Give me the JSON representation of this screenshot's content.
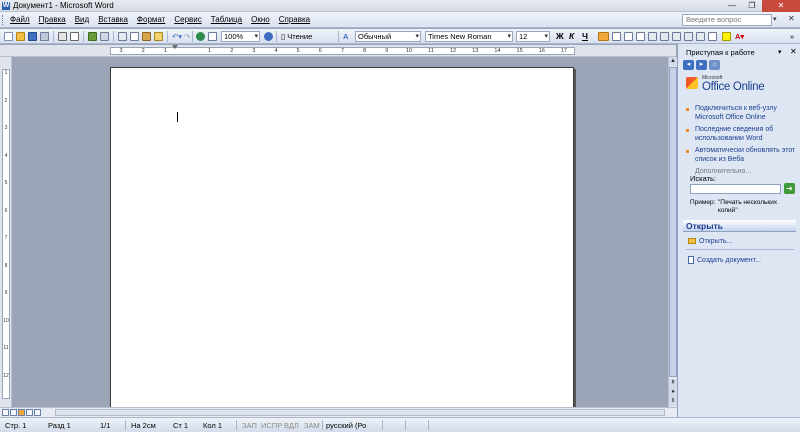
{
  "window": {
    "title": "Документ1 - Microsoft Word"
  },
  "menubar": {
    "items": [
      "Файл",
      "Правка",
      "Вид",
      "Вставка",
      "Формат",
      "Сервис",
      "Таблица",
      "Окно",
      "Справка"
    ],
    "help_placeholder": "Введите вопрос"
  },
  "toolbar": {
    "zoom": "100%",
    "reading_label": "Чтение",
    "style": "Обычный",
    "font": "Times New Roman",
    "font_size": "12",
    "bold": "Ж",
    "italic": "К",
    "underline": "Ч"
  },
  "ruler": {
    "ticks": [
      "3",
      "2",
      "1",
      "",
      "1",
      "2",
      "3",
      "4",
      "5",
      "6",
      "7",
      "8",
      "9",
      "10",
      "11",
      "12",
      "13",
      "14",
      "15",
      "16",
      "17"
    ]
  },
  "taskpane": {
    "title": "Приступая к работе",
    "logo_small": "Microsoft",
    "logo_text": "Office Online",
    "links": [
      "Подключиться к веб-узлу Microsoft Office Online",
      "Последние сведения об использовании Word",
      "Автоматически обновлять этот список из Веба"
    ],
    "more": "Дополнительно...",
    "search_label": "Искать:",
    "search_value": "",
    "example_label": "Пример:",
    "example_value": "\"Печать нескольких копий\"",
    "open_section": "Открыть",
    "open_item": "Открыть...",
    "create_item": "Создать документ..."
  },
  "statusbar": {
    "page": "Стр. 1",
    "section": "Разд 1",
    "pages": "1/1",
    "at": "На 2см",
    "line": "Ст 1",
    "col": "Кол 1",
    "rec": "ЗАП",
    "trk": "ИСПР",
    "ext": "ВДЛ",
    "ovr": "ЗАМ",
    "language": "русский (Ро"
  }
}
